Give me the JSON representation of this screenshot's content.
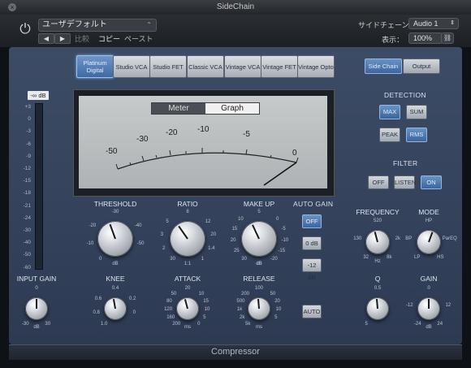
{
  "window": {
    "title": "SideChain"
  },
  "header": {
    "preset": "ユーザデフォルト",
    "compare": "比較",
    "copy": "コピー",
    "paste": "ペースト",
    "sidechain_label": "サイドチェーン：",
    "sidechain_value": "Audio 1",
    "view_label": "表示：",
    "view_value": "100%"
  },
  "models": [
    {
      "label": "Platinum Digital",
      "active": true
    },
    {
      "label": "Studio VCA",
      "active": false
    },
    {
      "label": "Studio FET",
      "active": false
    },
    {
      "label": "Classic VCA",
      "active": false
    },
    {
      "label": "Vintage VCA",
      "active": false
    },
    {
      "label": "Vintage FET",
      "active": false
    },
    {
      "label": "Vintage Opto",
      "active": false
    }
  ],
  "meter": {
    "mode_meter": "Meter",
    "mode_graph": "Graph",
    "active_mode": "Graph",
    "scale": [
      "-50",
      "-30",
      "-20",
      "-10",
      "-5",
      "0"
    ],
    "needle_value": 0
  },
  "gain_reduction": {
    "readout": "-∞ dB",
    "scale": [
      "+3",
      "0",
      "-3",
      "-6",
      "-9",
      "-12",
      "-15",
      "-18",
      "-21",
      "-24",
      "-30",
      "-40",
      "-50",
      "-60"
    ]
  },
  "output_tabs": {
    "sidechain": "Side Chain",
    "output": "Output"
  },
  "detection": {
    "title": "DETECTION",
    "max": "MAX",
    "sum": "SUM",
    "peak": "PEAK",
    "rms": "RMS"
  },
  "filter": {
    "title": "FILTER",
    "off": "OFF",
    "listen": "LISTEN",
    "on": "ON"
  },
  "auto_gain": {
    "title": "AUTO GAIN",
    "off": "OFF",
    "zero_db": "0 dB",
    "minus12": "-12 dB",
    "auto": "AUTO"
  },
  "knobs": {
    "threshold": {
      "label": "THRESHOLD",
      "ticks": [
        "-30",
        "-20",
        "-40",
        "-10",
        "-50",
        "0",
        "dB"
      ],
      "angle": -20
    },
    "ratio": {
      "label": "RATIO",
      "ticks": [
        "8",
        "5",
        "12",
        "3",
        "20",
        "2",
        "1.4",
        "30",
        "1",
        "1:1"
      ],
      "angle": -35
    },
    "makeup": {
      "label": "MAKE UP",
      "ticks": [
        "5",
        "10",
        "0",
        "15",
        "-5",
        "20",
        "-10",
        "25",
        "-15",
        "30",
        "-20",
        "dB",
        "dB"
      ],
      "angle": -25
    },
    "input_gain": {
      "label": "INPUT GAIN",
      "ticks": [
        "0",
        "-30",
        "30",
        "dB"
      ],
      "angle": 0
    },
    "knee": {
      "label": "KNEE",
      "ticks": [
        "0.4",
        "0.6",
        "0.2",
        "0.8",
        "0",
        "1.0"
      ],
      "angle": -10
    },
    "attack": {
      "label": "ATTACK",
      "ticks": [
        "20",
        "50",
        "10",
        "80",
        "15",
        "120",
        "10",
        "160",
        "5",
        "200",
        "0",
        "ms"
      ],
      "angle": -15
    },
    "release": {
      "label": "RELEASE",
      "ticks": [
        "100",
        "200",
        "50",
        "500",
        "20",
        "1k",
        "10",
        "2k",
        "5",
        "5k",
        "ms"
      ],
      "angle": -5
    },
    "frequency": {
      "label": "FREQUENCY",
      "ticks": [
        "520",
        "130",
        "2k",
        "32",
        "8k",
        "Hz"
      ],
      "angle": -15
    },
    "mode": {
      "label": "MODE",
      "ticks": [
        "HP",
        "BP",
        "ParEQ",
        "LP",
        "HS"
      ],
      "angle": 20
    },
    "q": {
      "label": "Q",
      "ticks": [
        "0.5",
        "5"
      ],
      "angle": -5
    },
    "gain": {
      "label": "GAIN",
      "ticks": [
        "0",
        "-12",
        "12",
        "-24",
        "24",
        "dB"
      ],
      "angle": 0
    }
  },
  "footer": {
    "plugin_name": "Compressor"
  },
  "colors": {
    "panel": "#3d4c66",
    "active_button": "#3e6aa3"
  }
}
